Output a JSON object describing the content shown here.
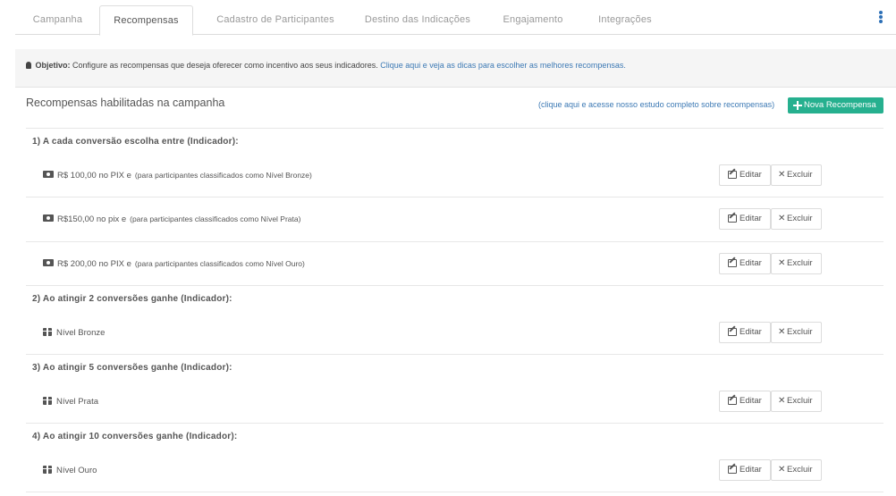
{
  "tabs": [
    {
      "label": "Campanha",
      "active": false
    },
    {
      "label": "Recompensas",
      "active": true
    },
    {
      "label": "Cadastro de Participantes",
      "active": false
    },
    {
      "label": "Destino das Indicações",
      "active": false
    },
    {
      "label": "Engajamento",
      "active": false
    },
    {
      "label": "Integrações",
      "active": false
    }
  ],
  "objective": {
    "label": "Objetivo:",
    "text": "Configure as recompensas que deseja oferecer como incentivo aos seus indicadores.",
    "link": "Clique aqui e veja as dicas para escolher as melhores recompensas."
  },
  "panel": {
    "title": "Recompensas habilitadas na campanha",
    "study_link": "(clique aqui e acesse nosso estudo completo sobre recompensas)",
    "new_button": "Nova Recompensa"
  },
  "actions": {
    "edit": "Editar",
    "delete": "Excluir"
  },
  "sections": [
    {
      "title": "1) A cada conversão escolha entre (Indicador):",
      "items": [
        {
          "icon": "money-icon",
          "label": "R$ 100,00 no PIX  e",
          "note": "(para participantes classificados como Nível Bronze)"
        },
        {
          "icon": "money-icon",
          "label": "R$150,00 no pix  e",
          "note": "(para participantes classificados como Nível Prata)"
        },
        {
          "icon": "money-icon",
          "label": "R$ 200,00 no PIX  e",
          "note": "(para participantes classificados como Nível Ouro)"
        }
      ]
    },
    {
      "title": "2) Ao atingir 2 conversões ganhe (Indicador):",
      "items": [
        {
          "icon": "gift-icon",
          "label": "Nível Bronze",
          "note": ""
        }
      ]
    },
    {
      "title": "3) Ao atingir 5 conversões ganhe (Indicador):",
      "items": [
        {
          "icon": "gift-icon",
          "label": "Nível Prata",
          "note": ""
        }
      ]
    },
    {
      "title": "4) Ao atingir 10 conversões ganhe (Indicador):",
      "items": [
        {
          "icon": "gift-icon",
          "label": "Nível Ouro",
          "note": ""
        }
      ]
    }
  ],
  "colors": {
    "accent": "#26b08f",
    "link": "#3c79b4",
    "kebab": "#2c6fb6"
  }
}
